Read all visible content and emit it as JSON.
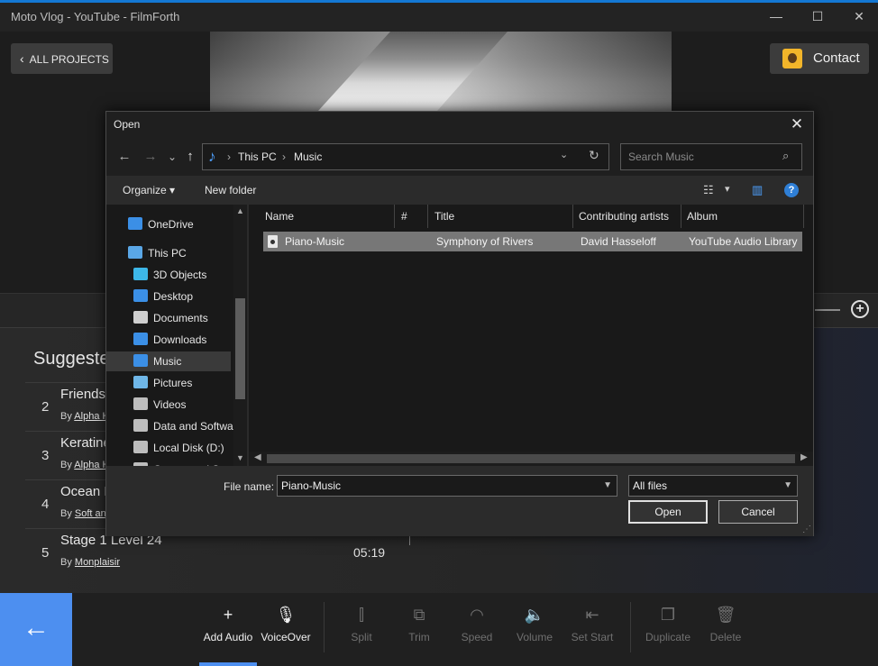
{
  "app": {
    "title": "Moto Vlog - YouTube - FilmForth",
    "minimize_glyph": "—",
    "maximize_glyph": "☐",
    "close_glyph": "✕",
    "all_projects_label": "ALL PROJECTS",
    "contact_label": "Contact",
    "accent_color": "#4d8ff0"
  },
  "suggested": {
    "title": "Suggeste",
    "tracks": [
      {
        "num": "2",
        "name": "Friends",
        "by_prefix": "By",
        "author": "Alpha H",
        "duration": ""
      },
      {
        "num": "3",
        "name": "Keratine",
        "by_prefix": "By",
        "author": "Alpha H",
        "duration": ""
      },
      {
        "num": "4",
        "name": "Ocean E",
        "by_prefix": "By",
        "author": "Soft an",
        "duration": ""
      },
      {
        "num": "5",
        "name": "Stage 1 Level 24",
        "by_prefix": "By",
        "author": "Monplaisir",
        "duration": "05:19"
      }
    ]
  },
  "toolbar": {
    "back_glyph": "←",
    "tools": [
      {
        "label": "Add Audio",
        "icon": "plus-icon",
        "glyph": "+",
        "active": true
      },
      {
        "label": "VoiceOver",
        "icon": "microphone-icon",
        "glyph": "🎙",
        "active": true
      },
      {
        "label": "Split",
        "icon": "split-icon",
        "glyph": "⫿",
        "active": false
      },
      {
        "label": "Trim",
        "icon": "trim-icon",
        "glyph": "⧉",
        "active": false
      },
      {
        "label": "Speed",
        "icon": "speedometer-icon",
        "glyph": "◠",
        "active": false
      },
      {
        "label": "Volume",
        "icon": "speaker-icon",
        "glyph": "🔈",
        "active": false
      },
      {
        "label": "Set Start",
        "icon": "set-start-icon",
        "glyph": "⇤",
        "active": false
      },
      {
        "label": "Duplicate",
        "icon": "duplicate-icon",
        "glyph": "❐",
        "active": false
      },
      {
        "label": "Delete",
        "icon": "trash-icon",
        "glyph": "🗑",
        "active": false
      }
    ]
  },
  "dialog": {
    "title": "Open",
    "close_glyph": "✕",
    "nav": {
      "back": "←",
      "forward": "→",
      "recent": "⌄",
      "up": "↑"
    },
    "address": {
      "sep": "›",
      "segments": [
        "This PC",
        "Music"
      ],
      "dropdown": "⌄",
      "refresh": "↻"
    },
    "search_placeholder": "Search Music",
    "commands": {
      "organize": "Organize",
      "new_folder": "New folder",
      "organize_caret": "▾",
      "view_caret": "▾",
      "help": "?"
    },
    "navpane": [
      {
        "label": "OneDrive",
        "icon": "cloud-icon",
        "color": "#3b8fe6"
      },
      {
        "label": "This PC",
        "icon": "computer-icon",
        "color": "#5aa7e6"
      },
      {
        "label": "3D Objects",
        "icon": "cube-icon",
        "color": "#3db7e8"
      },
      {
        "label": "Desktop",
        "icon": "desktop-icon",
        "color": "#3b8fe6"
      },
      {
        "label": "Documents",
        "icon": "document-icon",
        "color": "#cfcfcf"
      },
      {
        "label": "Downloads",
        "icon": "download-icon",
        "color": "#3b8fe6"
      },
      {
        "label": "Music",
        "icon": "music-icon",
        "color": "#3b8fe6"
      },
      {
        "label": "Pictures",
        "icon": "pictures-icon",
        "color": "#6fb7e8"
      },
      {
        "label": "Videos",
        "icon": "videos-icon",
        "color": "#bdbdbd"
      },
      {
        "label": "Data and Softwa",
        "icon": "drive-icon",
        "color": "#bdbdbd"
      },
      {
        "label": "Local Disk (D:)",
        "icon": "drive-icon",
        "color": "#bdbdbd"
      },
      {
        "label": "Games and Stor",
        "icon": "drive-icon",
        "color": "#bdbdbd"
      }
    ],
    "selected_nav": "Music",
    "columns": [
      "Name",
      "#",
      "Title",
      "Contributing artists",
      "Album"
    ],
    "files": [
      {
        "name": "Piano-Music",
        "num": "",
        "title": "Symphony of Rivers",
        "artist": "David Hasseloff",
        "album": "YouTube Audio Library"
      }
    ],
    "file_name_label": "File name:",
    "file_name_value": "Piano-Music",
    "file_type_value": "All files",
    "open_label": "Open",
    "cancel_label": "Cancel"
  }
}
